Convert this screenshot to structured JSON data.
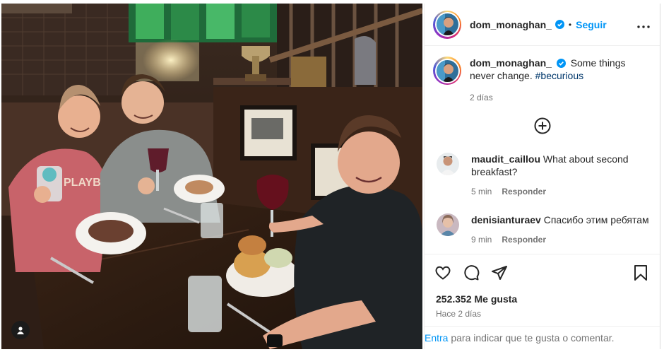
{
  "post": {
    "username": "dom_monaghan_",
    "follow_label": "Seguir",
    "dot": "•",
    "more_label": "•••",
    "caption_text": "Some things never change.",
    "caption_hashtag": "#becurious",
    "caption_time": "2 días"
  },
  "comments": [
    {
      "username": "maudit_caillou",
      "text": "What about second breakfast?",
      "time": "5 min",
      "reply_label": "Responder"
    },
    {
      "username": "denisianturaev",
      "text": "Спасибо этим ребятам",
      "time": "9 min",
      "reply_label": "Responder"
    }
  ],
  "stats": {
    "likes": "252.352 Me gusta",
    "time_ago": "Hace 2 días"
  },
  "footer": {
    "login_link": "Entra",
    "login_text": "para indicar que te gusta o comentar."
  },
  "colors": {
    "accent": "#0095f6",
    "hashtag": "#00376b",
    "verified": "#0095f6",
    "muted": "#737373"
  },
  "icons": [
    "verified-icon",
    "more-icon",
    "add-comment-icon",
    "like-icon",
    "comment-icon",
    "share-icon",
    "save-icon",
    "user-tag-icon"
  ]
}
